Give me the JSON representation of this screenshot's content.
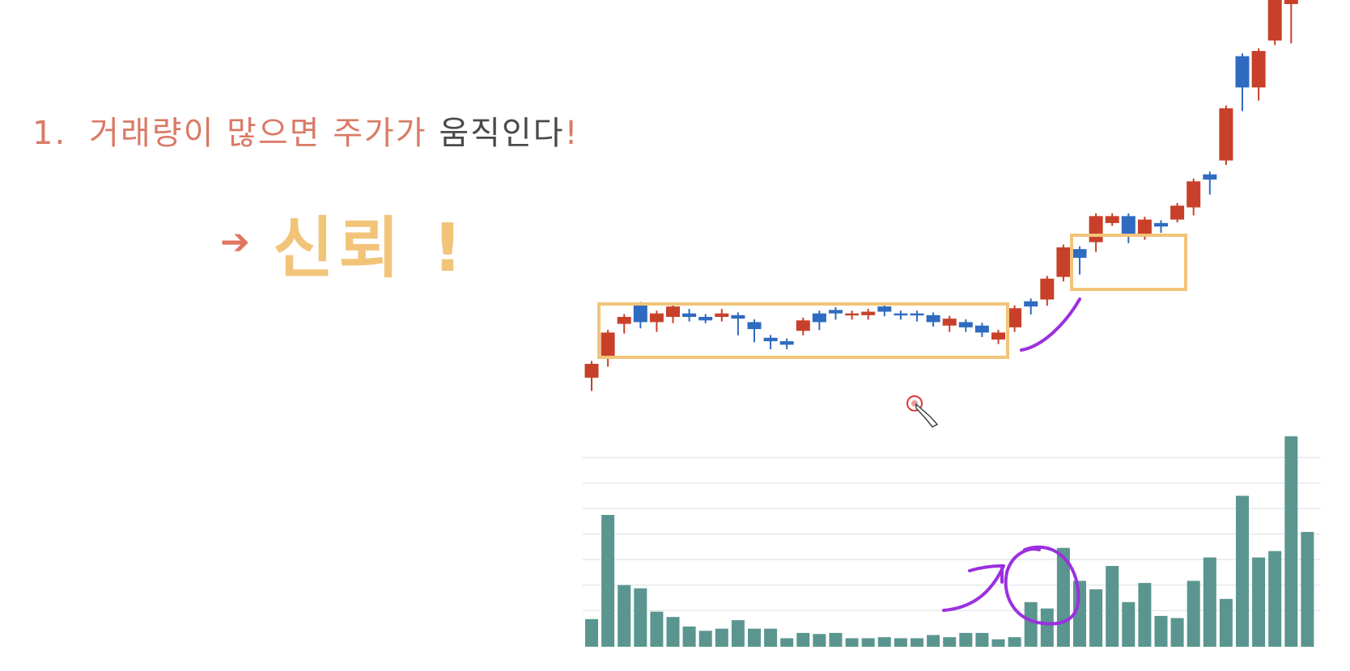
{
  "slide": {
    "heading_number": "1.",
    "heading_part1": "거래량이 많으면 주가가",
    "heading_part2": "움직인다",
    "heading_end": "!",
    "subheading_arrow": "➔",
    "subheading_text": "신뢰 !"
  },
  "colors": {
    "heading_accent": "#d97b66",
    "heading_dark": "#4a4a4a",
    "subheading": "#f2c47a",
    "candle_up": "#c8402a",
    "candle_down": "#2f6bc0",
    "volume_bar": "#5a968f",
    "highlight_box": "#f2c47a",
    "annotation": "#9b30e0"
  },
  "chart_data": [
    {
      "type": "candlestick",
      "ylim": [
        0,
        100
      ],
      "x": [
        1,
        2,
        3,
        4,
        5,
        6,
        7,
        8,
        9,
        10,
        11,
        12,
        13,
        14,
        15,
        16,
        17,
        18,
        19,
        20,
        21,
        22,
        23,
        24,
        25,
        26,
        27,
        28,
        29,
        30,
        31,
        32,
        33,
        34,
        35,
        36,
        37,
        38,
        39,
        40,
        41,
        42,
        43,
        44,
        45,
        46
      ],
      "candles": [
        {
          "o": 2.5,
          "h": 2.5,
          "l": -0.5,
          "c": 6.5,
          "dir": "up"
        },
        {
          "o": 8,
          "h": 12.5,
          "l": 6.5,
          "c": 15.5,
          "dir": "up"
        },
        {
          "o": 18,
          "h": 19,
          "l": 16,
          "c": 20,
          "dir": "up"
        },
        {
          "o": 18.5,
          "h": 20,
          "l": 17.5,
          "c": 23.5,
          "dir": "down"
        },
        {
          "o": 18.5,
          "h": 20,
          "l": 16.5,
          "c": 21,
          "dir": "up"
        },
        {
          "o": 20,
          "h": 21,
          "l": 19,
          "c": 23,
          "dir": "up"
        },
        {
          "o": 20,
          "h": 21.5,
          "l": 19.5,
          "c": 21,
          "dir": "down"
        },
        {
          "o": 19,
          "h": 20,
          "l": 19,
          "c": 20,
          "dir": "down"
        },
        {
          "o": 20,
          "h": 21.5,
          "l": 19.5,
          "c": 21,
          "dir": "up"
        },
        {
          "o": 19.5,
          "h": 17,
          "l": 15.5,
          "c": 20.5,
          "dir": "down"
        },
        {
          "o": 16.5,
          "h": 18,
          "l": 13.5,
          "c": 18.5,
          "dir": "down"
        },
        {
          "o": 13,
          "h": 13.5,
          "l": 11.5,
          "c": 14,
          "dir": "down"
        },
        {
          "o": 12,
          "h": 13,
          "l": 11.5,
          "c": 13,
          "dir": "down"
        },
        {
          "o": 16,
          "h": 19,
          "l": 15.5,
          "c": 19,
          "dir": "up"
        },
        {
          "o": 18.5,
          "h": 21,
          "l": 17,
          "c": 21,
          "dir": "down"
        },
        {
          "o": 21,
          "h": 22,
          "l": 20,
          "c": 22,
          "dir": "down"
        },
        {
          "o": 20.5,
          "h": 21,
          "l": 20,
          "c": 21,
          "dir": "up"
        },
        {
          "o": 20.5,
          "h": 21.5,
          "l": 20,
          "c": 21.5,
          "dir": "up"
        },
        {
          "o": 21.5,
          "h": 23,
          "l": 21,
          "c": 23,
          "dir": "down"
        },
        {
          "o": 20.5,
          "h": 21,
          "l": 20,
          "c": 21,
          "dir": "down"
        },
        {
          "o": 20.5,
          "h": 21,
          "l": 19.5,
          "c": 21,
          "dir": "down"
        },
        {
          "o": 18.5,
          "h": 20,
          "l": 18,
          "c": 20.5,
          "dir": "down"
        },
        {
          "o": 17.5,
          "h": 19,
          "l": 16.5,
          "c": 19.5,
          "dir": "up"
        },
        {
          "o": 17,
          "h": 18.5,
          "l": 16.5,
          "c": 18.5,
          "dir": "down"
        },
        {
          "o": 15.5,
          "h": 17,
          "l": 15,
          "c": 17.5,
          "dir": "down"
        },
        {
          "o": 13.5,
          "h": 15,
          "l": 13,
          "c": 15.5,
          "dir": "up"
        },
        {
          "o": 17,
          "h": 22.5,
          "l": 16.5,
          "c": 22.5,
          "dir": "up"
        },
        {
          "o": 23,
          "h": 24.5,
          "l": 21.5,
          "c": 24.5,
          "dir": "down"
        },
        {
          "o": 25,
          "h": 31,
          "l": 24,
          "c": 31,
          "dir": "up"
        },
        {
          "o": 31.5,
          "h": 40,
          "l": 31,
          "c": 40,
          "dir": "up"
        },
        {
          "o": 37,
          "h": 38,
          "l": 33,
          "c": 39.5,
          "dir": "down"
        },
        {
          "o": 41.5,
          "h": 49,
          "l": 39.5,
          "c": 49,
          "dir": "up"
        },
        {
          "o": 47,
          "h": 49,
          "l": 47,
          "c": 49,
          "dir": "up"
        },
        {
          "o": 43.5,
          "h": 49,
          "l": 42,
          "c": 49,
          "dir": "down"
        },
        {
          "o": 43.5,
          "h": 48,
          "l": 43,
          "c": 48,
          "dir": "up"
        },
        {
          "o": 46,
          "h": 47,
          "l": 45,
          "c": 47,
          "dir": "down"
        },
        {
          "o": 48,
          "h": 48.5,
          "l": 48,
          "c": 52,
          "dir": "up"
        },
        {
          "o": 51.5,
          "h": 59,
          "l": 50,
          "c": 59,
          "dir": "up"
        },
        {
          "o": 59.5,
          "h": 61,
          "l": 56,
          "c": 61,
          "dir": "down"
        },
        {
          "o": 65,
          "h": 80,
          "l": 64.5,
          "c": 80,
          "dir": "up"
        },
        {
          "o": 86,
          "h": 95,
          "l": 80,
          "c": 95,
          "dir": "down"
        },
        {
          "o": 86,
          "h": 96.5,
          "l": 83,
          "c": 96.5,
          "dir": "up"
        },
        {
          "o": 99.5,
          "h": 117,
          "l": 99,
          "c": 117,
          "dir": "up"
        },
        {
          "o": 110,
          "h": 113,
          "l": 99.5,
          "c": 116,
          "dir": "up"
        }
      ]
    },
    {
      "type": "bar",
      "ylim": [
        0,
        100
      ],
      "values": [
        13,
        62,
        29,
        27.5,
        16.5,
        14,
        9.5,
        7.5,
        8.5,
        12.5,
        8.5,
        8.5,
        4,
        6.5,
        6,
        6.5,
        4,
        4,
        4.5,
        4,
        4,
        5.5,
        4.5,
        6.5,
        6.5,
        3.5,
        4.5,
        21,
        18,
        46.5,
        31,
        27,
        38,
        21,
        30,
        14.5,
        13.5,
        31,
        42,
        22.5,
        71,
        42,
        45,
        99,
        54
      ],
      "grid": true
    }
  ]
}
